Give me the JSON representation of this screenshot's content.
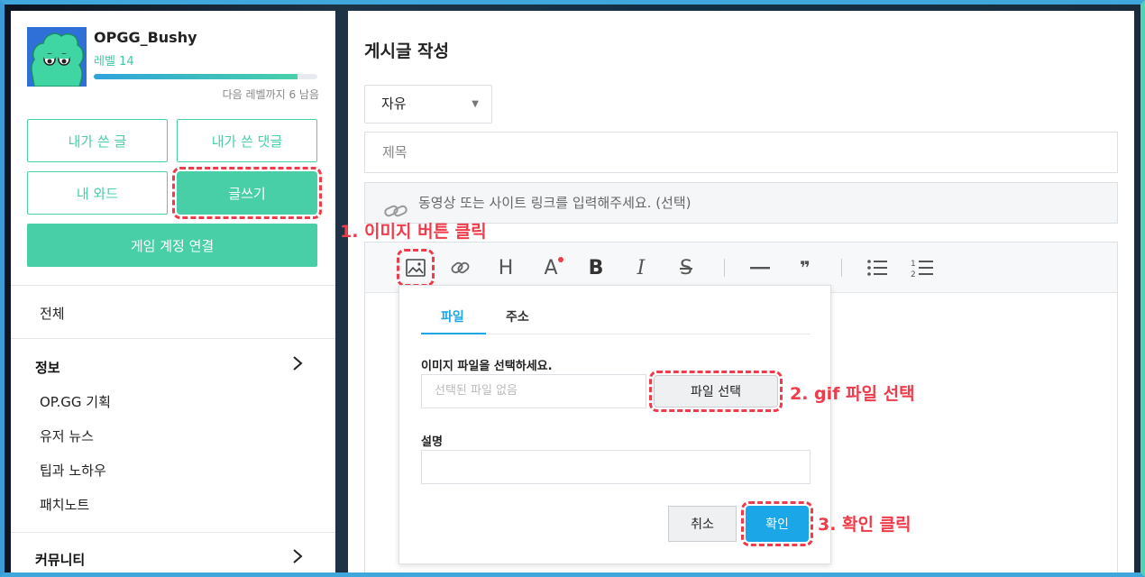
{
  "profile": {
    "username": "OPGG_Bushy",
    "level": "레벨 14",
    "progress_fraction": 0.91,
    "next_level": "다음 레벨까지 6 남음"
  },
  "buttons": {
    "my_posts": "내가 쓴 글",
    "my_comments": "내가 쓴 댓글",
    "my_wow": "내 와드",
    "write": "글쓰기",
    "link_account": "게임 계정 연결"
  },
  "menu": {
    "all": "전체",
    "info_header": "정보",
    "info_items": [
      "OP.GG 기획",
      "유저 뉴스",
      "팁과 노하우",
      "패치노트"
    ],
    "community_header": "커뮤니티"
  },
  "editor": {
    "page_title": "게시글 작성",
    "category": "자유",
    "title_placeholder": "제목",
    "link_placeholder": "동영상 또는 사이트 링크를 입력해주세요. (선택)"
  },
  "popup": {
    "tab_file": "파일",
    "tab_url": "주소",
    "file_label": "이미지 파일을 선택하세요.",
    "file_placeholder": "선택된 파일 없음",
    "choose_file": "파일 선택",
    "desc_label": "설명",
    "cancel": "취소",
    "confirm": "확인"
  },
  "annotations": {
    "step1": "1. 이미지 버튼 클릭",
    "step2": "2. gif 파일 선택",
    "step3": "3. 확인 클릭"
  },
  "colors": {
    "accent_green": "#48cfa8",
    "accent_blue": "#1ba6e8",
    "annotation_red": "#ef3b4a"
  }
}
